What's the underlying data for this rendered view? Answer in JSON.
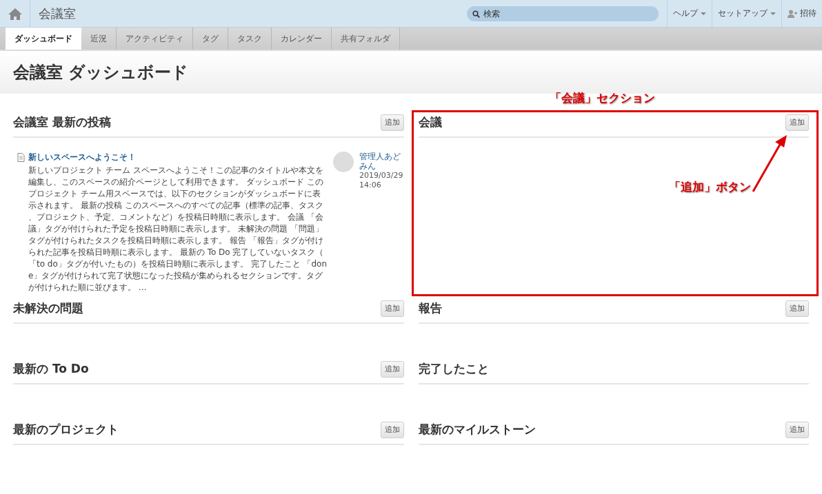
{
  "header": {
    "title": "会議室",
    "search": {
      "placeholder": "検索"
    },
    "menus": [
      {
        "label": "ヘルプ",
        "kind": "dropdown"
      },
      {
        "label": "セットアップ",
        "kind": "dropdown"
      },
      {
        "label": "招待",
        "kind": "invite"
      }
    ]
  },
  "tabs": [
    {
      "label": "ダッシュボード",
      "selected": true
    },
    {
      "label": "近況",
      "selected": false
    },
    {
      "label": "アクティビティ",
      "selected": false
    },
    {
      "label": "タグ",
      "selected": false
    },
    {
      "label": "タスク",
      "selected": false
    },
    {
      "label": "カレンダー",
      "selected": false
    },
    {
      "label": "共有フォルダ",
      "selected": false
    }
  ],
  "page_title": "会議室 ダッシュボード",
  "sections": [
    {
      "title": "会議室 最新の投稿",
      "add_button": "追加",
      "posts": [
        {
          "title": "新しいスペースへようこそ！",
          "body": "新しいプロジェクト チーム スペースへようこそ！この記事のタイトルや本文を編集し、このスペースの紹介ページとして利用できます。 ダッシュボード このプロジェクト チーム用スペースでは、以下のセクションがダッシュボードに表示されます。 最新の投稿 このスペースへのすべての記事（標準の記事、タスク、プロジェクト、予定、コメントなど）を投稿日時順に表示します。 会議 「会議」タグが付けられた予定を投稿日時順に表示します。 未解決の問題 「問題」タグが付けられたタスクを投稿日時順に表示します。 報告 「報告」タグが付けられた記事を投稿日時順に表示します。 最新の To Do 完了していないタスク（「to do」タグが付いたもの）を投稿日時順に表示します。 完了したこと 「done」タグが付けられて完了状態になった投稿が集められるセクションです。タグが付けられた順に並びます。 …",
          "author": "管理人あどみん",
          "date": "2019/03/29 14:06"
        }
      ]
    },
    {
      "title": "会議",
      "add_button": "追加",
      "highlighted": true
    },
    {
      "title": "未解決の問題",
      "add_button": "追加"
    },
    {
      "title": "報告",
      "add_button": "追加"
    },
    {
      "title": "最新の To Do",
      "add_button": "追加"
    },
    {
      "title": "完了したこと"
    },
    {
      "title": "最新のプロジェクト",
      "add_button": "追加"
    },
    {
      "title": "最新のマイルストーン",
      "add_button": "追加"
    }
  ],
  "annotations": [
    {
      "kind": "section-label",
      "text": "「会議」セクション"
    },
    {
      "kind": "button-label",
      "text": "「追加」ボタン"
    }
  ]
}
